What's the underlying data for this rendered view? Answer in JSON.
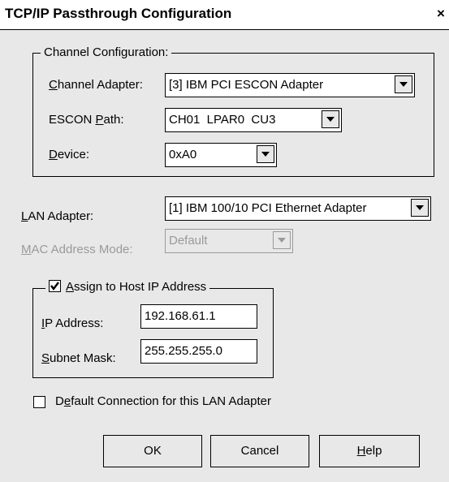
{
  "window": {
    "title": "TCP/IP Passthrough Configuration",
    "close_glyph": "×"
  },
  "channel_group": {
    "title": "Channel Configuration:",
    "channel_adapter": {
      "label": "Channel Adapter:",
      "value": "[3] IBM PCI ESCON Adapter"
    },
    "escon_path": {
      "label": "ESCON Path:",
      "value": "CH01  LPAR0  CU3"
    },
    "device": {
      "label": "Device:",
      "value": "0xA0"
    }
  },
  "lan_adapter": {
    "label": "LAN Adapter:",
    "value": "[1] IBM 100/10 PCI Ethernet Adapter"
  },
  "mac_mode": {
    "label": "MAC Address Mode:",
    "value": "Default",
    "enabled": false
  },
  "host_ip_group": {
    "checkbox_label": "Assign to Host IP Address",
    "checked": true,
    "ip_address": {
      "label": "IP Address:",
      "value": "192.168.61.1"
    },
    "subnet_mask": {
      "label": "Subnet Mask:",
      "value": "255.255.255.0"
    }
  },
  "default_connection": {
    "label": "Default Connection for this LAN Adapter",
    "checked": false
  },
  "buttons": {
    "ok": "OK",
    "cancel": "Cancel",
    "help": "Help"
  },
  "colors": {
    "dialog_bg": "#e8e8e8",
    "disabled_text": "#9a9a9a",
    "field_bg": "#ffffff"
  },
  "icons": {
    "dropdown": "chevron-down-icon",
    "check": "check-icon"
  }
}
